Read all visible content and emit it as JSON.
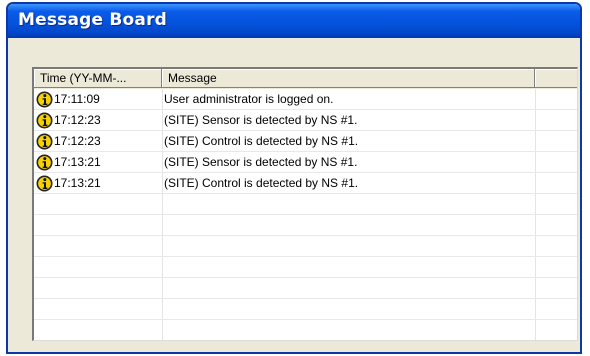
{
  "window": {
    "title": "Message Board"
  },
  "listview": {
    "columns": [
      {
        "label": "Time (YY-MM-..."
      },
      {
        "label": "Message"
      },
      {
        "label": ""
      }
    ],
    "rows": [
      {
        "icon": "info-icon",
        "time": "17:11:09",
        "message": "User  administrator  is logged on."
      },
      {
        "icon": "info-icon",
        "time": "17:12:23",
        "message": "(SITE) Sensor is detected by NS #1."
      },
      {
        "icon": "info-icon",
        "time": "17:12:23",
        "message": "(SITE) Control is detected by NS #1."
      },
      {
        "icon": "info-icon",
        "time": "17:13:21",
        "message": "(SITE) Sensor is detected by NS #1."
      },
      {
        "icon": "info-icon",
        "time": "17:13:21",
        "message": "(SITE) Control is detected by NS #1."
      }
    ]
  },
  "colors": {
    "titlebar": "#0453de",
    "window_bg": "#ece9d8",
    "icon_yellow": "#f7d000"
  }
}
